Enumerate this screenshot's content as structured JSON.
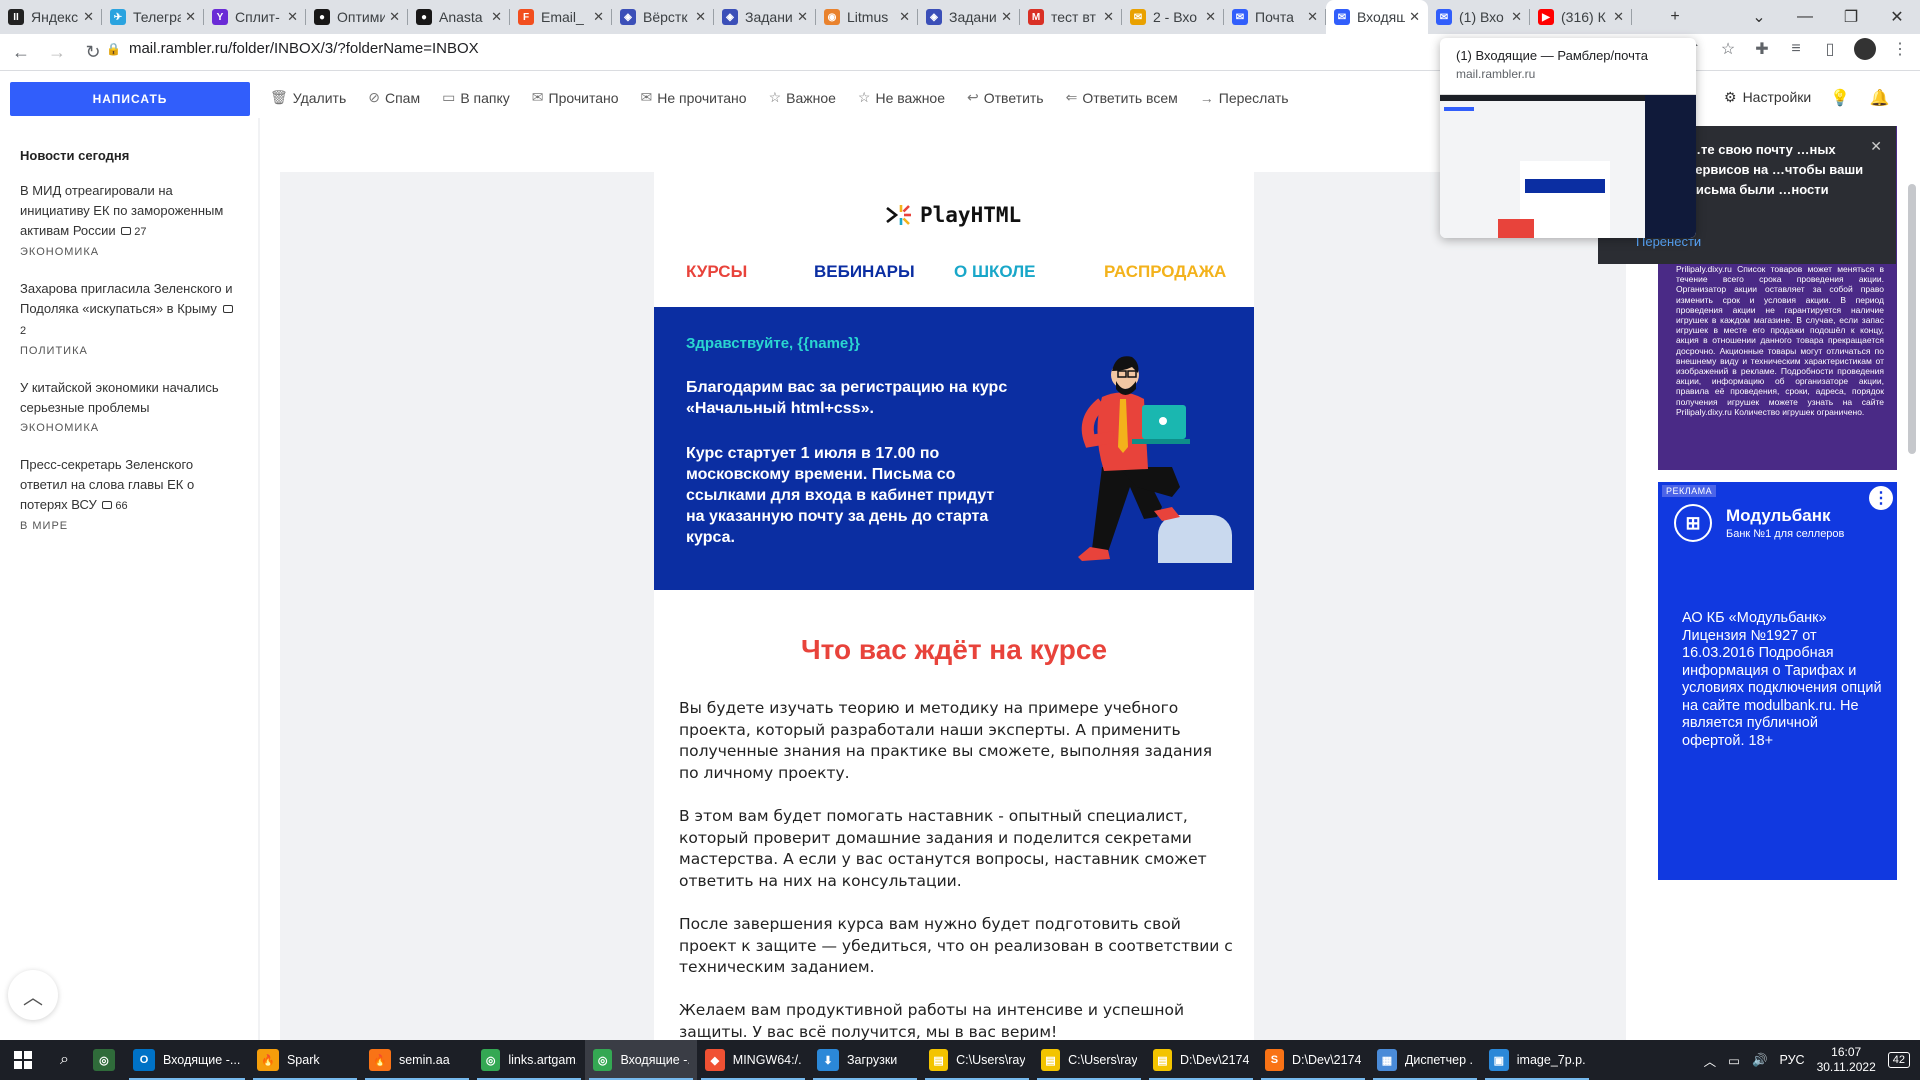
{
  "browser": {
    "tabs": [
      {
        "label": "Яндекс",
        "color": "#222222",
        "glyph": "II"
      },
      {
        "label": "Телеграм",
        "color": "#2aa3df",
        "glyph": "✈"
      },
      {
        "label": "Сплит-",
        "color": "#6a2bd6",
        "glyph": "Y"
      },
      {
        "label": "Оптими",
        "color": "#181717",
        "glyph": "●"
      },
      {
        "label": "Anasta",
        "color": "#181717",
        "glyph": "●"
      },
      {
        "label": "Email_",
        "color": "#f24e1e",
        "glyph": "F"
      },
      {
        "label": "Вёрстк",
        "color": "#3b4fb8",
        "glyph": "◈"
      },
      {
        "label": "Задани",
        "color": "#3b4fb8",
        "glyph": "◈"
      },
      {
        "label": "Litmus",
        "color": "#e9822d",
        "glyph": "◉"
      },
      {
        "label": "Задани",
        "color": "#3b4fb8",
        "glyph": "◈"
      },
      {
        "label": "тест вт",
        "color": "#d93025",
        "glyph": "M"
      },
      {
        "label": "2 - Вхо",
        "color": "#e9a100",
        "glyph": "✉"
      },
      {
        "label": "Почта",
        "color": "#315efb",
        "glyph": "✉"
      },
      {
        "label": "Входящ",
        "color": "#315efb",
        "glyph": "✉",
        "active": true
      },
      {
        "label": "(1) Вхо",
        "color": "#315efb",
        "glyph": "✉"
      },
      {
        "label": "(316) К",
        "color": "#ff0000",
        "glyph": "▶"
      }
    ],
    "url": "mail.rambler.ru/folder/INBOX/3/?folderName=INBOX",
    "hovercard": {
      "title": "(1) Входящие — Рамблер/почта",
      "domain": "mail.rambler.ru"
    }
  },
  "toolbar": {
    "compose": "НАПИСАТЬ",
    "actions": [
      {
        "label": "Удалить",
        "icon": "trash-icon",
        "glyph": "🗑"
      },
      {
        "label": "Спам",
        "icon": "spam-icon",
        "glyph": "⊘"
      },
      {
        "label": "В папку",
        "icon": "folder-icon",
        "glyph": "▭"
      },
      {
        "label": "Прочитано",
        "icon": "envelope-open-icon",
        "glyph": "✉"
      },
      {
        "label": "Не прочитано",
        "icon": "envelope-icon",
        "glyph": "✉"
      },
      {
        "label": "Важное",
        "icon": "star-icon",
        "glyph": "☆"
      },
      {
        "label": "Не важное",
        "icon": "star-off-icon",
        "glyph": "☆"
      },
      {
        "label": "Ответить",
        "icon": "reply-icon",
        "glyph": "↩"
      },
      {
        "label": "Ответить всем",
        "icon": "reply-all-icon",
        "glyph": "⇐"
      },
      {
        "label": "Переслать",
        "icon": "forward-icon",
        "glyph": "→"
      }
    ],
    "settings": "Настройки"
  },
  "news": {
    "heading": "Новости сегодня",
    "items": [
      {
        "text": "В МИД отреагировали на инициативу ЕК по замороженным активам России",
        "comments": "27",
        "category": "ЭКОНОМИКА"
      },
      {
        "text": "Захарова пригласила Зеленского и Подоляка «искупаться» в Крыму",
        "comments": "2",
        "category": "ПОЛИТИКА"
      },
      {
        "text": "У китайской экономики начались серьезные проблемы",
        "comments": "",
        "category": "ЭКОНОМИКА"
      },
      {
        "text": "Пресс-секретарь Зеленского ответил на слова главы ЕК о потерях ВСУ",
        "comments": "66",
        "category": "В МИРЕ"
      }
    ]
  },
  "email": {
    "logo": "PlayHTML",
    "nav": [
      {
        "label": "КУРСЫ",
        "color": "#e8433b"
      },
      {
        "label": "ВЕБИНАРЫ",
        "color": "#0b2ea2"
      },
      {
        "label": "О ШКОЛЕ",
        "color": "#19a7c9"
      },
      {
        "label": "РАСПРОДАЖА",
        "color": "#f3b21b"
      }
    ],
    "greeting": "Здравствуйте, {{name}}",
    "hero_p1": "Благодарим вас за регистрацию на курс «Начальный html+css».",
    "hero_p2": "Курс стартует 1 июля в 17.00 по московскому времени. Письма со ссылками для входа в кабинет придут на указанную почту за день до старта курса.",
    "section_title": "Что вас ждёт на курсе",
    "paragraphs": [
      "Вы будете изучать теорию и методику на примере учебного проекта, который разработали наши эксперты. А применить полученные знания на практике вы сможете, выполняя задания по личному проекту.",
      "В этом вам будет помогать наставник - опытный специалист, который проверит домашние задания и поделится секретами мастерства. А если у вас останутся вопросы, наставник сможет ответить на них на консультации.",
      "После завершения курса вам нужно будет подготовить свой проект к защите — убедиться, что он реализован в соответствии с техническим заданием.",
      "Желаем вам продуктивной работы на интенсиве и успешной защиты. У вас всё получится, мы в вас верим!"
    ]
  },
  "promo": {
    "text": "…те свою почту …ных сервисов на …чтобы ваши письма были …ности",
    "move": "Перенести"
  },
  "ads": {
    "ad1_text": "Prilipaly.dixy.ru Список товаров может меняться в течение всего срока проведения акции. Организатор акции оставляет за собой право изменить срок и условия акции. В период проведения акции не гарантируется наличие игрушек в каждом магазине. В случае, если запас игрушек в месте его продажи подошёл к концу, акция в отношении данного товара прекращается досрочно. Акционные товары могут отличаться по внешнему виду и техническим характеристикам от изображений в рекламе. Подробности проведения акции, информацию об организаторе акции, правила её проведения, сроки, адреса, порядок получения игрушек можете узнать на сайте Prilipaly.dixy.ru Количество игрушек ограничено.",
    "ad2_tag": "РЕКЛАМА",
    "ad2_brand": "Модульбанк",
    "ad2_sub": "Банк №1 для селлеров",
    "ad2_body": "АО КБ «Модульбанк» Лицензия №1927 от 16.03.2016 Подробная информация о Тарифах и условиях подключения опций на сайте modulbank.ru. Не является публичной офертой. 18+"
  },
  "taskbar": {
    "items": [
      {
        "label": "Входящие -...",
        "color": "#0072c6",
        "glyph": "O"
      },
      {
        "label": "Spark",
        "color": "#f59e0b",
        "glyph": "🔥"
      },
      {
        "label": "semin.aa",
        "color": "#f97316",
        "glyph": "🔥"
      },
      {
        "label": "links.artgam...",
        "color": "#34a853",
        "glyph": "◎"
      },
      {
        "label": "Входящие -...",
        "color": "#34a853",
        "glyph": "◎",
        "active": true
      },
      {
        "label": "MINGW64:/...",
        "color": "#f05133",
        "glyph": "◆"
      },
      {
        "label": "Загрузки",
        "color": "#2b88d8",
        "glyph": "⬇"
      },
      {
        "label": "C:\\Users\\ray...",
        "color": "#f3c400",
        "glyph": "▤"
      },
      {
        "label": "C:\\Users\\ray...",
        "color": "#f3c400",
        "glyph": "▤"
      },
      {
        "label": "D:\\Dev\\2174...",
        "color": "#f3c400",
        "glyph": "▤"
      },
      {
        "label": "D:\\Dev\\2174...",
        "color": "#f97316",
        "glyph": "S"
      },
      {
        "label": "Диспетчер ...",
        "color": "#4a8bd8",
        "glyph": "▦"
      },
      {
        "label": "image_7p.p...",
        "color": "#2b88d8",
        "glyph": "▣"
      }
    ],
    "lang": "РУС",
    "time": "16:07",
    "date": "30.11.2022",
    "notifications": "42"
  }
}
